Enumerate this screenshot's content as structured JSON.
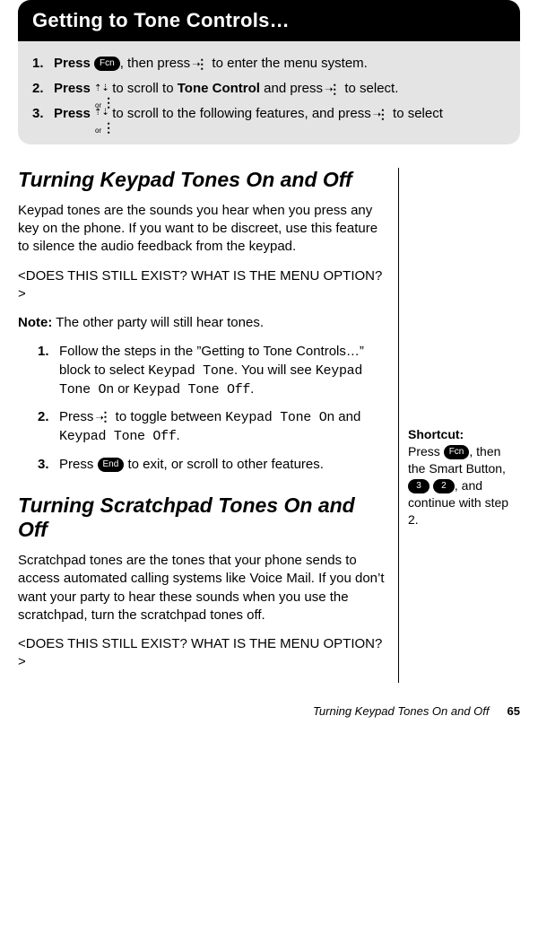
{
  "header": {
    "title": "Getting to Tone Controls…"
  },
  "intro_steps": [
    {
      "num": "1.",
      "pre_bold": "Press ",
      "key1": "Fcn",
      "mid": ", then press ",
      "icon2": "menu",
      "post": " to enter the menu system."
    },
    {
      "num": "2.",
      "pre_bold": "Press  ",
      "icon1": "scroll",
      "mid": " to scroll to ",
      "bold_mid": "Tone Control",
      "mid2": " and press ",
      "icon2": "menu",
      "post": " to select."
    },
    {
      "num": "3.",
      "pre_bold": "Press  ",
      "icon1": "scroll",
      "mid": " to scroll to the following features, and press ",
      "icon2": "menu",
      "post": " to select"
    }
  ],
  "section1": {
    "title": "Turning Keypad Tones On and Off",
    "p1": "Keypad tones are the sounds you hear when you press any key on the phone. If you want to be discreet, use this feature to silence the audio feedback from the keypad.",
    "p2": "<DOES THIS STILL EXIST? WHAT IS THE MENU OPTION?>",
    "note_label": "Note:",
    "note_text": " The other party will still hear tones.",
    "steps": [
      {
        "num": "1.",
        "text_a": "Follow the steps in the ”Getting to Tone Controls…” block to select ",
        "mono_a": "Keypad Tone",
        "text_b": ". You will see ",
        "mono_b": "Keypad Tone On",
        "text_c": " or ",
        "mono_c": "Keypad Tone Off",
        "text_d": "."
      },
      {
        "num": "2.",
        "text_a": "Press ",
        "icon": "menu",
        "text_b": " to toggle between ",
        "mono_a": "Keypad Tone On",
        "text_c": " and ",
        "mono_b": "Keypad Tone Off",
        "text_d": "."
      },
      {
        "num": "3.",
        "text_a": "Press ",
        "key": "End",
        "text_b": " to exit, or scroll to other features."
      }
    ]
  },
  "section2": {
    "title": "Turning Scratchpad Tones On and Off",
    "p1": "Scratchpad tones are the tones that your phone sends to access automated calling systems like Voice Mail. If you don’t want your party to hear these sounds when you use the scratchpad, turn the scratchpad tones off.",
    "p2": "<DOES THIS STILL EXIST? WHAT IS THE MENU OPTION?>"
  },
  "sidebar": {
    "shortcut_label": "Shortcut:",
    "pre": " Press ",
    "key1": "Fcn",
    "mid1": ", then the Smart Button, ",
    "key2": "3",
    "key3": "2",
    "post": ", and continue with step 2."
  },
  "footer": {
    "title": "Turning Keypad Tones On and Off",
    "page": "65"
  }
}
